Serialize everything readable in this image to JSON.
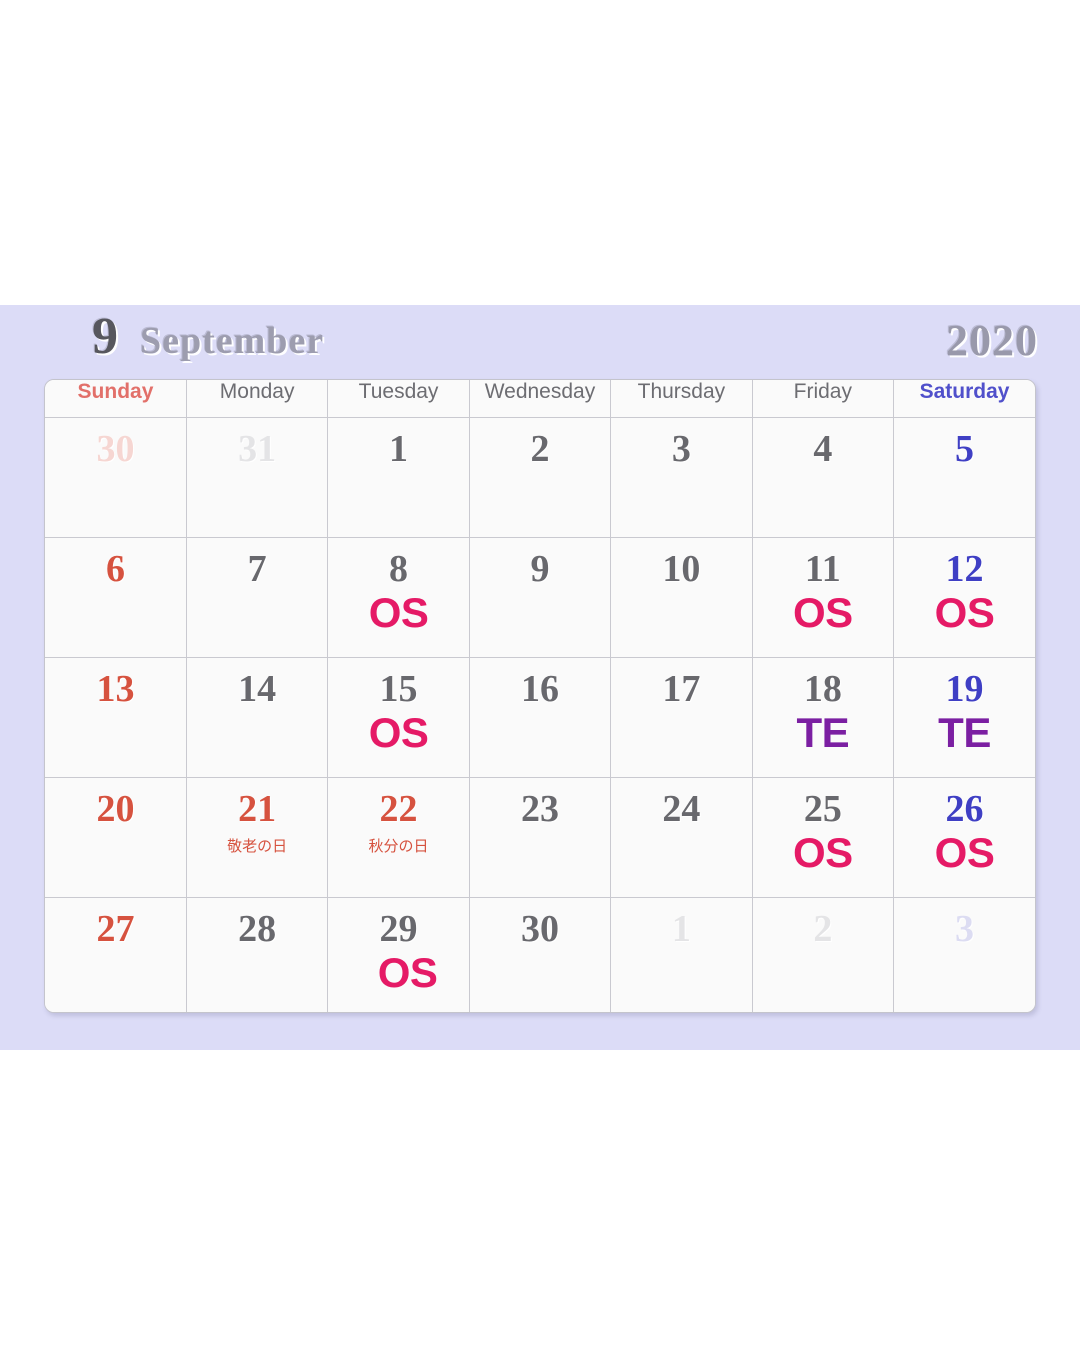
{
  "header": {
    "month_number": "9",
    "month_name": "September",
    "year": "2020"
  },
  "colors": {
    "panel_background": "#dcdcf7",
    "cell_background": "#fafafa",
    "grid_border": "#c9c9d0",
    "sunday_red": "#d6523f",
    "saturday_blue": "#3f3fc4",
    "weekday_gray": "#68686d",
    "event_os_pink": "#e51a66",
    "event_te_purple": "#7b1fa2",
    "header_gray": "#9d9daf"
  },
  "weekdays": [
    {
      "label": "Sunday",
      "kind": "sun"
    },
    {
      "label": "Monday",
      "kind": "wd"
    },
    {
      "label": "Tuesday",
      "kind": "wd"
    },
    {
      "label": "Wednesday",
      "kind": "wd"
    },
    {
      "label": "Thursday",
      "kind": "wd"
    },
    {
      "label": "Friday",
      "kind": "wd"
    },
    {
      "label": "Saturday",
      "kind": "sat"
    }
  ],
  "weeks": [
    [
      {
        "day": "30",
        "kind": "sun",
        "out": true,
        "event": "",
        "holiday": ""
      },
      {
        "day": "31",
        "kind": "wd",
        "out": true,
        "event": "",
        "holiday": ""
      },
      {
        "day": "1",
        "kind": "wd",
        "out": false,
        "event": "",
        "holiday": ""
      },
      {
        "day": "2",
        "kind": "wd",
        "out": false,
        "event": "",
        "holiday": ""
      },
      {
        "day": "3",
        "kind": "wd",
        "out": false,
        "event": "",
        "holiday": ""
      },
      {
        "day": "4",
        "kind": "wd",
        "out": false,
        "event": "",
        "holiday": ""
      },
      {
        "day": "5",
        "kind": "sat",
        "out": false,
        "event": "",
        "holiday": ""
      }
    ],
    [
      {
        "day": "6",
        "kind": "sun",
        "out": false,
        "event": "",
        "holiday": ""
      },
      {
        "day": "7",
        "kind": "wd",
        "out": false,
        "event": "",
        "holiday": ""
      },
      {
        "day": "8",
        "kind": "wd",
        "out": false,
        "event": "OS",
        "holiday": ""
      },
      {
        "day": "9",
        "kind": "wd",
        "out": false,
        "event": "",
        "holiday": ""
      },
      {
        "day": "10",
        "kind": "wd",
        "out": false,
        "event": "",
        "holiday": ""
      },
      {
        "day": "11",
        "kind": "wd",
        "out": false,
        "event": "OS",
        "holiday": ""
      },
      {
        "day": "12",
        "kind": "sat",
        "out": false,
        "event": "OS",
        "holiday": ""
      }
    ],
    [
      {
        "day": "13",
        "kind": "sun",
        "out": false,
        "event": "",
        "holiday": ""
      },
      {
        "day": "14",
        "kind": "wd",
        "out": false,
        "event": "",
        "holiday": ""
      },
      {
        "day": "15",
        "kind": "wd",
        "out": false,
        "event": "OS",
        "holiday": ""
      },
      {
        "day": "16",
        "kind": "wd",
        "out": false,
        "event": "",
        "holiday": ""
      },
      {
        "day": "17",
        "kind": "wd",
        "out": false,
        "event": "",
        "holiday": ""
      },
      {
        "day": "18",
        "kind": "wd",
        "out": false,
        "event": "TE",
        "holiday": ""
      },
      {
        "day": "19",
        "kind": "sat",
        "out": false,
        "event": "TE",
        "holiday": ""
      }
    ],
    [
      {
        "day": "20",
        "kind": "sun",
        "out": false,
        "event": "",
        "holiday": ""
      },
      {
        "day": "21",
        "kind": "holi",
        "out": false,
        "event": "",
        "holiday": "敬老の日"
      },
      {
        "day": "22",
        "kind": "holi",
        "out": false,
        "event": "",
        "holiday": "秋分の日"
      },
      {
        "day": "23",
        "kind": "wd",
        "out": false,
        "event": "",
        "holiday": ""
      },
      {
        "day": "24",
        "kind": "wd",
        "out": false,
        "event": "",
        "holiday": ""
      },
      {
        "day": "25",
        "kind": "wd",
        "out": false,
        "event": "OS",
        "holiday": ""
      },
      {
        "day": "26",
        "kind": "sat",
        "out": false,
        "event": "OS",
        "holiday": ""
      }
    ],
    [
      {
        "day": "27",
        "kind": "sun",
        "out": false,
        "event": "",
        "holiday": ""
      },
      {
        "day": "28",
        "kind": "wd",
        "out": false,
        "event": "",
        "holiday": ""
      },
      {
        "day": "29",
        "kind": "wd",
        "out": false,
        "event": "OS",
        "holiday": ""
      },
      {
        "day": "30",
        "kind": "wd",
        "out": false,
        "event": "",
        "holiday": ""
      },
      {
        "day": "1",
        "kind": "wd",
        "out": true,
        "event": "",
        "holiday": ""
      },
      {
        "day": "2",
        "kind": "wd",
        "out": true,
        "event": "",
        "holiday": ""
      },
      {
        "day": "3",
        "kind": "sat",
        "out": true,
        "event": "",
        "holiday": ""
      }
    ]
  ]
}
